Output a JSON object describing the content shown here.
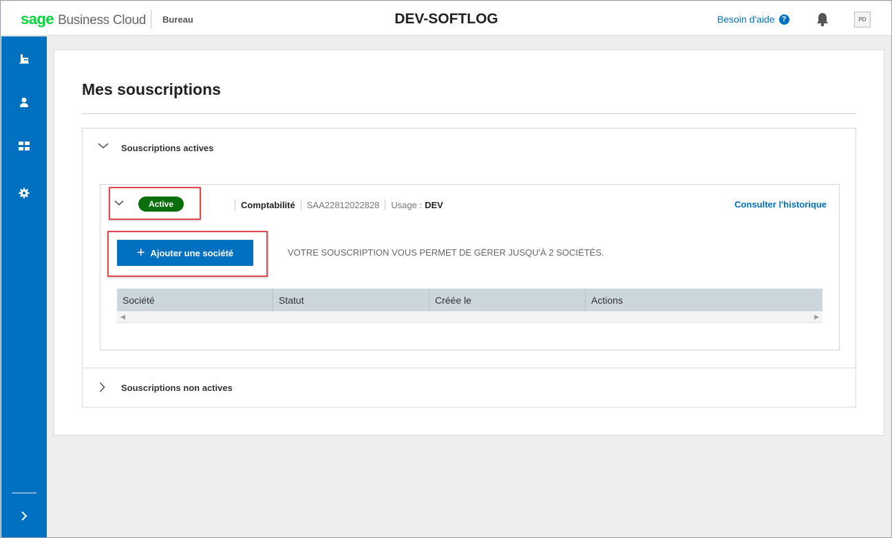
{
  "header": {
    "logo_brand": "sage",
    "logo_product": "Business Cloud",
    "section": "Bureau",
    "title": "DEV-SOFTLOG",
    "help_label": "Besoin d'aide",
    "user_initials": "PD"
  },
  "sidebar": {
    "items": [
      {
        "icon": "building-icon"
      },
      {
        "icon": "user-icon"
      },
      {
        "icon": "grid-icon"
      },
      {
        "icon": "gear-icon"
      }
    ],
    "expand_icon": "chevron-right-icon"
  },
  "page": {
    "title": "Mes souscriptions",
    "active_section_label": "Souscriptions actives",
    "inactive_section_label": "Souscriptions non actives"
  },
  "subscription": {
    "status": "Active",
    "product": "Comptabilité",
    "code": "SAA22812022828",
    "usage_label": "Usage :",
    "usage_value": "DEV",
    "history_link": "Consulter l'historique",
    "add_button": "Ajouter une société",
    "info_text": "VOTRE SOUSCRIPTION VOUS PERMET DE GÉRER JUSQU'À 2 SOCIÉTÉS."
  },
  "table": {
    "columns": [
      "Société",
      "Statut",
      "Créée le",
      "Actions"
    ],
    "rows": []
  },
  "colors": {
    "accent": "#0070c0",
    "status_active": "#0a6e0a",
    "highlight": "#e0474c",
    "sage_green": "#00d639"
  }
}
